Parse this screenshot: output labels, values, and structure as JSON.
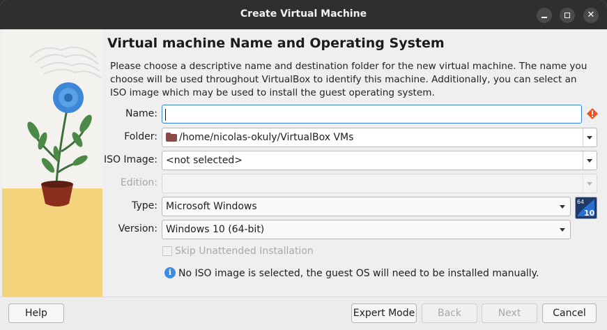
{
  "window": {
    "title": "Create Virtual Machine"
  },
  "page": {
    "heading": "Virtual machine Name and Operating System",
    "description": "Please choose a descriptive name and destination folder for the new virtual machine. The name you choose will be used throughout VirtualBox to identify this machine. Additionally, you can select an ISO image which may be used to install the guest operating system."
  },
  "form": {
    "name_label": "Name:",
    "name_value": "",
    "folder_label": "Folder:",
    "folder_value": "/home/nicolas-okuly/VirtualBox VMs",
    "iso_label": "ISO Image:",
    "iso_value": "<not selected>",
    "edition_label": "Edition:",
    "edition_value": "",
    "type_label": "Type:",
    "type_value": "Microsoft Windows",
    "version_label": "Version:",
    "version_value": "Windows 10 (64-bit)",
    "os_badge_top": "64",
    "os_badge_bottom": "10",
    "skip_unattended_label": "Skip Unattended Installation",
    "info_text": "No ISO image is selected, the guest OS will need to be installed manually."
  },
  "buttons": {
    "help": "Help",
    "expert": "Expert Mode",
    "back": "Back",
    "next": "Next",
    "cancel": "Cancel"
  },
  "colors": {
    "accent": "#3584e4",
    "warning": "#e95420",
    "titlebar": "#2f2f2f"
  }
}
